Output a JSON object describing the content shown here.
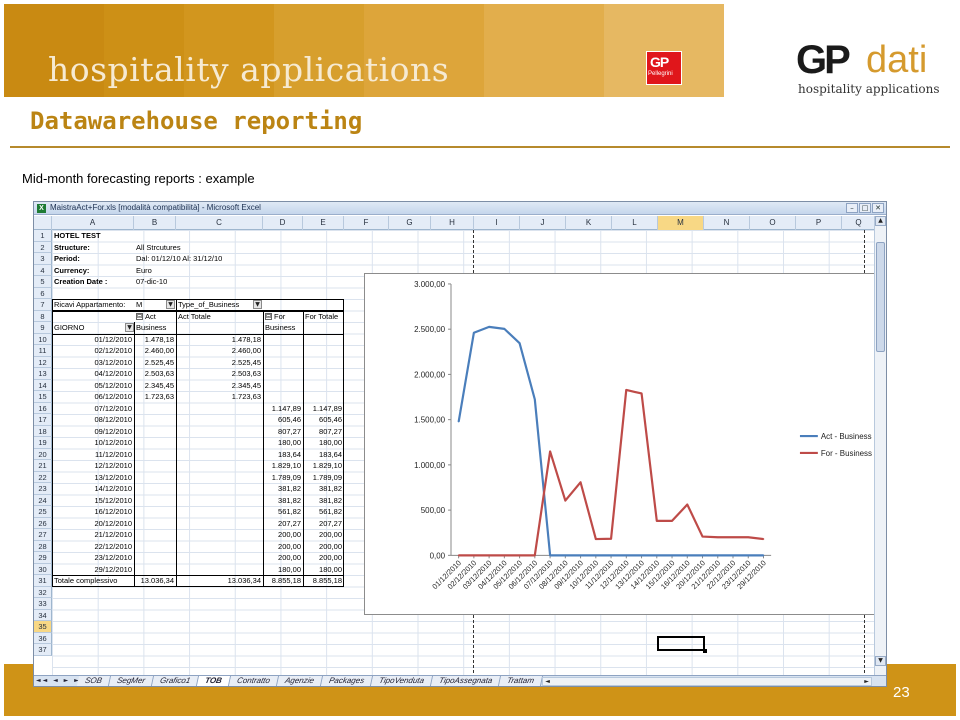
{
  "slide": {
    "banner_title": "hospitality applications",
    "badge_gp": "GP",
    "badge_sub": "Pellegrini",
    "logo_main": "GP",
    "logo_accent": "dati",
    "logo_sub": "hospitality applications",
    "title": "Datawarehouse reporting",
    "subtitle": "Mid-month forecasting reports :  example",
    "page_number": "23",
    "colors": {
      "banner": "#cf9317",
      "title": "#bb8413",
      "footer": "#cf9317"
    }
  },
  "excel": {
    "window_title": "MaistraAct+For.xls  [modalità compatibilità] - Microsoft Excel",
    "window_buttons": [
      "–",
      "□",
      "✕"
    ],
    "app_icon": "X",
    "columns": [
      "A",
      "B",
      "C",
      "D",
      "E",
      "F",
      "G",
      "H",
      "I",
      "J",
      "K",
      "L",
      "M",
      "N",
      "O",
      "P",
      "Q"
    ],
    "selected_column": "M",
    "selected_row": "35",
    "row_numbers": [
      "1",
      "2",
      "3",
      "4",
      "5",
      "6",
      "7",
      "8",
      "9",
      "10",
      "11",
      "12",
      "13",
      "14",
      "15",
      "16",
      "17",
      "18",
      "19",
      "20",
      "21",
      "22",
      "23",
      "24",
      "25",
      "26",
      "27",
      "28",
      "29",
      "30",
      "31",
      "32",
      "33",
      "34",
      "35",
      "36",
      "37"
    ],
    "header": {
      "hotel": "HOTEL TEST",
      "structure_label": "Structure:",
      "structure_value": "All Strcutures",
      "period_label": "Period:",
      "period_value": "Dal: 01/12/10  Al: 31/12/10",
      "currency_label": "Currency:",
      "currency_value": "Euro",
      "creation_label": "Creation Date :",
      "creation_value": "07-dic-10"
    },
    "pivot": {
      "filter_label": "Ricavi Appartamento:",
      "filter_value": "M",
      "type_field": "Type_of_Business",
      "act": "Act",
      "act_total": "Act Totale",
      "for": "For",
      "for_total": "For Totale",
      "row_field": "GIORNO",
      "business": "Business",
      "rows": [
        {
          "date": "01/12/2010",
          "act": "1.478,18",
          "act_tot": "1.478,18",
          "for": "",
          "for_tot": ""
        },
        {
          "date": "02/12/2010",
          "act": "2.460,00",
          "act_tot": "2.460,00",
          "for": "",
          "for_tot": ""
        },
        {
          "date": "03/12/2010",
          "act": "2.525,45",
          "act_tot": "2.525,45",
          "for": "",
          "for_tot": ""
        },
        {
          "date": "04/12/2010",
          "act": "2.503,63",
          "act_tot": "2.503,63",
          "for": "",
          "for_tot": ""
        },
        {
          "date": "05/12/2010",
          "act": "2.345,45",
          "act_tot": "2.345,45",
          "for": "",
          "for_tot": ""
        },
        {
          "date": "06/12/2010",
          "act": "1.723,63",
          "act_tot": "1.723,63",
          "for": "",
          "for_tot": ""
        },
        {
          "date": "07/12/2010",
          "act": "",
          "act_tot": "",
          "for": "1.147,89",
          "for_tot": "1.147,89"
        },
        {
          "date": "08/12/2010",
          "act": "",
          "act_tot": "",
          "for": "605,46",
          "for_tot": "605,46"
        },
        {
          "date": "09/12/2010",
          "act": "",
          "act_tot": "",
          "for": "807,27",
          "for_tot": "807,27"
        },
        {
          "date": "10/12/2010",
          "act": "",
          "act_tot": "",
          "for": "180,00",
          "for_tot": "180,00"
        },
        {
          "date": "11/12/2010",
          "act": "",
          "act_tot": "",
          "for": "183,64",
          "for_tot": "183,64"
        },
        {
          "date": "12/12/2010",
          "act": "",
          "act_tot": "",
          "for": "1.829,10",
          "for_tot": "1.829,10"
        },
        {
          "date": "13/12/2010",
          "act": "",
          "act_tot": "",
          "for": "1.789,09",
          "for_tot": "1.789,09"
        },
        {
          "date": "14/12/2010",
          "act": "",
          "act_tot": "",
          "for": "381,82",
          "for_tot": "381,82"
        },
        {
          "date": "15/12/2010",
          "act": "",
          "act_tot": "",
          "for": "381,82",
          "for_tot": "381,82"
        },
        {
          "date": "16/12/2010",
          "act": "",
          "act_tot": "",
          "for": "561,82",
          "for_tot": "561,82"
        },
        {
          "date": "20/12/2010",
          "act": "",
          "act_tot": "",
          "for": "207,27",
          "for_tot": "207,27"
        },
        {
          "date": "21/12/2010",
          "act": "",
          "act_tot": "",
          "for": "200,00",
          "for_tot": "200,00"
        },
        {
          "date": "22/12/2010",
          "act": "",
          "act_tot": "",
          "for": "200,00",
          "for_tot": "200,00"
        },
        {
          "date": "23/12/2010",
          "act": "",
          "act_tot": "",
          "for": "200,00",
          "for_tot": "200,00"
        },
        {
          "date": "29/12/2010",
          "act": "",
          "act_tot": "",
          "for": "180,00",
          "for_tot": "180,00"
        }
      ],
      "total_label": "Totale complessivo",
      "total_act": "13.036,34",
      "total_act_tot": "13.036,34",
      "total_for": "8.855,18",
      "total_for_tot": "8.855,18"
    },
    "sheet_tabs": [
      "SOB",
      "SegMer",
      "Grafico1",
      "TOB",
      "Contratto",
      "Agenzie",
      "Packages",
      "TipoVenduta",
      "TipoAssegnata",
      "Trattam"
    ],
    "active_tab": "TOB",
    "tab_nav": "◄◄ ◄ ► ►►"
  },
  "chart_data": {
    "type": "line",
    "categories": [
      "01/12/2010",
      "02/12/2010",
      "03/12/2010",
      "04/12/2010",
      "05/12/2010",
      "06/12/2010",
      "07/12/2010",
      "08/12/2010",
      "09/12/2010",
      "10/12/2010",
      "11/12/2010",
      "12/12/2010",
      "13/12/2010",
      "14/12/2010",
      "15/12/2010",
      "16/12/2010",
      "20/12/2010",
      "21/12/2010",
      "22/12/2010",
      "23/12/2010",
      "29/12/2010"
    ],
    "series": [
      {
        "name": "Act - Business",
        "color": "#4a7ebb",
        "values": [
          1478.18,
          2460.0,
          2525.45,
          2503.63,
          2345.45,
          1723.63,
          0,
          0,
          0,
          0,
          0,
          0,
          0,
          0,
          0,
          0,
          0,
          0,
          0,
          0,
          0
        ]
      },
      {
        "name": "For - Business",
        "color": "#be4b48",
        "values": [
          0,
          0,
          0,
          0,
          0,
          0,
          1147.89,
          605.46,
          807.27,
          180.0,
          183.64,
          1829.1,
          1789.09,
          381.82,
          381.82,
          561.82,
          207.27,
          200.0,
          200.0,
          200.0,
          180.0
        ]
      }
    ],
    "y_ticks": [
      "0,00",
      "500,00",
      "1.000,00",
      "1.500,00",
      "2.000,00",
      "2.500,00",
      "3.000,00"
    ],
    "ylim": [
      0,
      3000
    ],
    "grid": false,
    "legend_position": "right",
    "title": "",
    "xlabel": "",
    "ylabel": ""
  }
}
